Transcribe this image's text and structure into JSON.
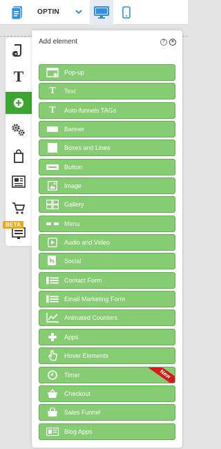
{
  "header": {
    "page_selector_value": "OPTIN",
    "doc_icon": "document-icon",
    "desktop_icon": "desktop-icon",
    "mobile_icon": "mobile-icon",
    "accent_color": "#2f8fe0"
  },
  "rail": {
    "items": [
      {
        "icon": "layers-icon"
      },
      {
        "icon": "text-icon",
        "glyph": "T"
      },
      {
        "icon": "add-element-icon",
        "active": true
      },
      {
        "icon": "settings-icon"
      },
      {
        "icon": "shopping-bag-icon"
      },
      {
        "icon": "article-icon"
      },
      {
        "icon": "cart-icon"
      },
      {
        "icon": "screen-icon"
      }
    ],
    "beta_label": "BETA",
    "active_color": "#3da532"
  },
  "panel": {
    "title": "Add element",
    "help_glyph": "?",
    "close_glyph": "×",
    "button_color": "#86cc72",
    "items": [
      {
        "label": "Pop-up",
        "icon": "popup-icon"
      },
      {
        "label": "Text",
        "icon": "text-icon",
        "glyph": "T"
      },
      {
        "label": "Auto-funnels TAGs",
        "icon": "tag-text-icon",
        "glyph": "T"
      },
      {
        "label": "Banner",
        "icon": "banner-icon"
      },
      {
        "label": "Boxes and Lines",
        "icon": "box-icon"
      },
      {
        "label": "Button",
        "icon": "button-icon"
      },
      {
        "label": "Image",
        "icon": "image-icon"
      },
      {
        "label": "Gallery",
        "icon": "gallery-icon"
      },
      {
        "label": "Menu",
        "icon": "menu-icon"
      },
      {
        "label": "Audio and Video",
        "icon": "video-icon"
      },
      {
        "label": "Social",
        "icon": "social-icon"
      },
      {
        "label": "Contact Form",
        "icon": "form-icon"
      },
      {
        "label": "Email Marketing Form",
        "icon": "email-form-icon"
      },
      {
        "label": "Animated Counters",
        "icon": "chart-icon"
      },
      {
        "label": "Apps",
        "icon": "plus-icon"
      },
      {
        "label": "Hover Elements",
        "icon": "pointer-icon"
      },
      {
        "label": "Timer",
        "icon": "clock-icon",
        "badge": "New"
      },
      {
        "label": "Checkout",
        "icon": "basket-icon"
      },
      {
        "label": "Sales Funnel",
        "icon": "funnel-icon"
      },
      {
        "label": "Blog Apps",
        "icon": "blog-icon"
      }
    ]
  }
}
